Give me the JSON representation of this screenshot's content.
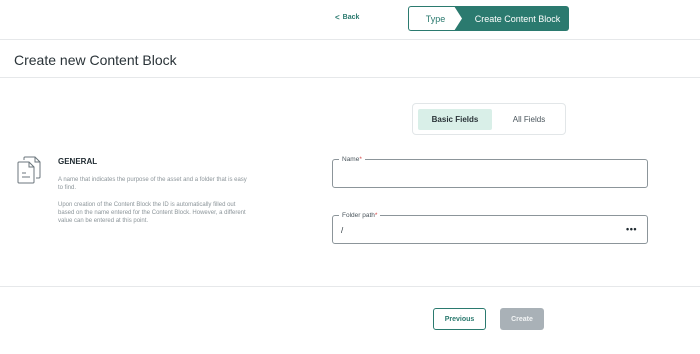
{
  "wizard": {
    "back_chevron": "<",
    "back_label": "Back",
    "step_type": "Type",
    "step_active": "Create Content Block",
    "accent_color": "#2b7a6f"
  },
  "header": {
    "title": "Create new Content Block"
  },
  "field_toggle": {
    "basic_label": "Basic Fields",
    "all_label": "All Fields",
    "selected": "Basic Fields"
  },
  "general": {
    "icon": "document-copy-icon",
    "heading": "GENERAL",
    "description_1": "A name that indicates the purpose of the asset and a folder that is easy to find.",
    "description_2": "Upon creation of the Content Block the ID is automatically filled out based on the name entered for the Content Block. However, a different value can be entered at this point."
  },
  "form": {
    "name_label": "Name",
    "name_required": "*",
    "name_value": "",
    "folder_label": "Folder path",
    "folder_required": "*",
    "folder_value": "/",
    "folder_more_icon": "more-horizontal-icon",
    "folder_more_glyph": "•••"
  },
  "footer": {
    "previous_label": "Previous",
    "create_label": "Create"
  }
}
